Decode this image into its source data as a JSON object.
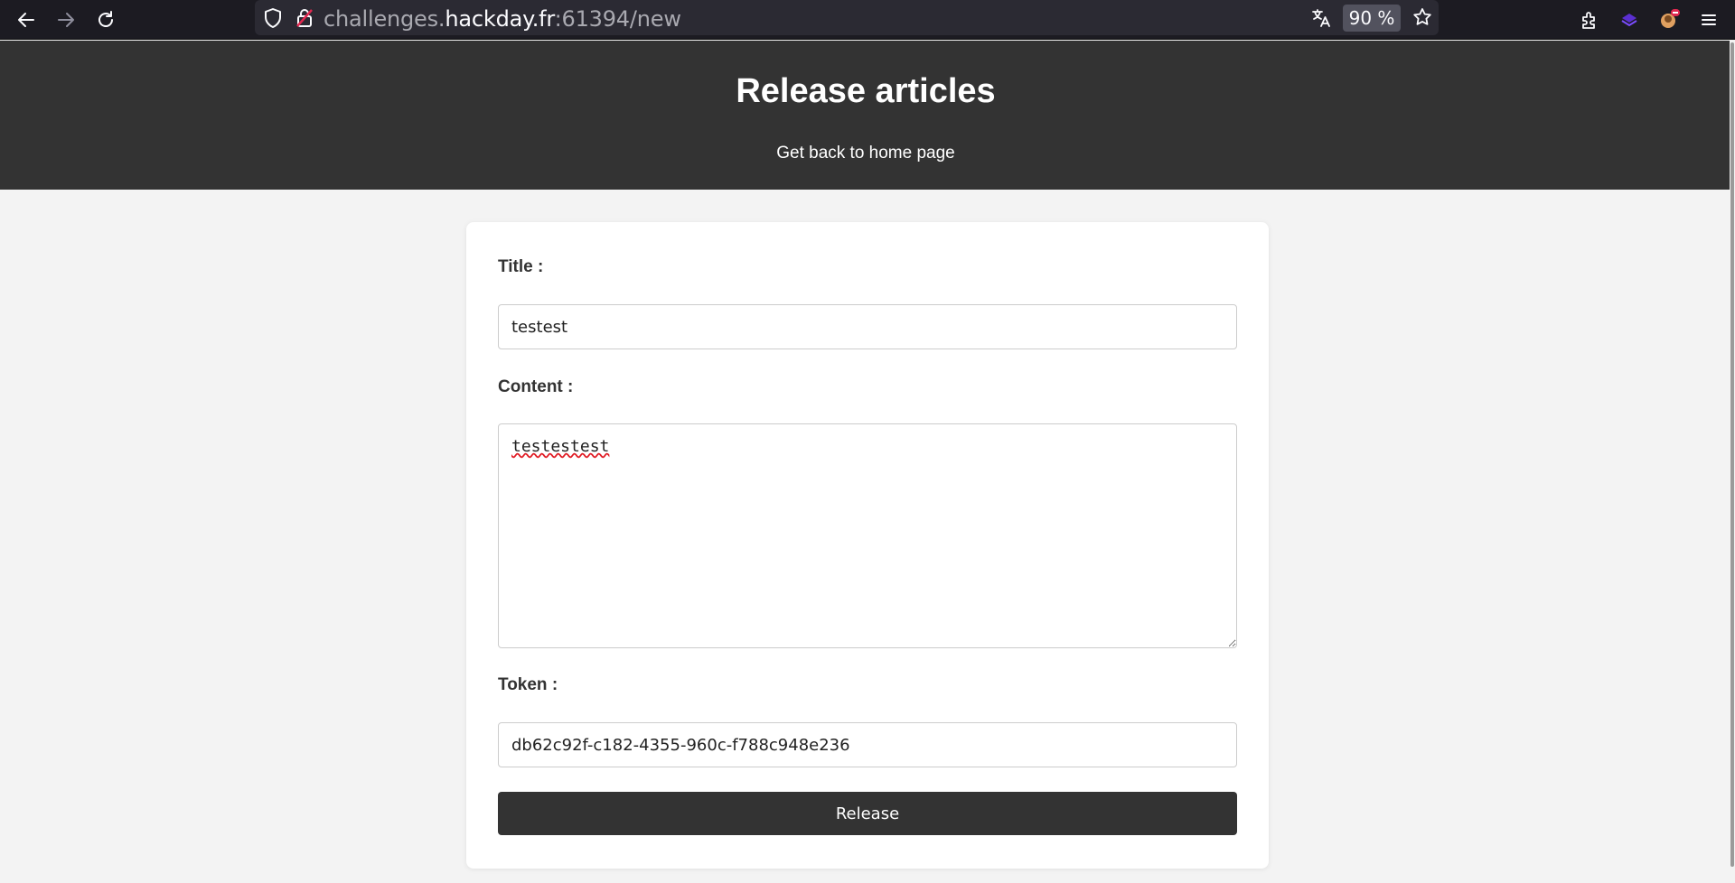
{
  "browser": {
    "url_prefix": "challenges.",
    "url_host": "hackday.fr",
    "url_suffix": ":61394/new",
    "zoom": "90 %",
    "icons": [
      "back-icon",
      "forward-icon",
      "reload-icon",
      "shield-icon",
      "lock-icon",
      "translate-icon",
      "star-icon",
      "extensions-icon",
      "extension-icon",
      "profile-icon",
      "menu-icon"
    ]
  },
  "header": {
    "title": "Release articles",
    "home_link": "Get back to home page"
  },
  "form": {
    "title_label": "Title :",
    "title_value": "testest",
    "content_label": "Content :",
    "content_value": "testestest",
    "token_label": "Token :",
    "token_value": "db62c92f-c182-4355-960c-f788c948e236",
    "submit_label": "Release"
  },
  "colors": {
    "header_bg": "#333333",
    "page_bg": "#f3f3f3",
    "button_bg": "#333333",
    "browser_bg": "#1c1b22"
  }
}
